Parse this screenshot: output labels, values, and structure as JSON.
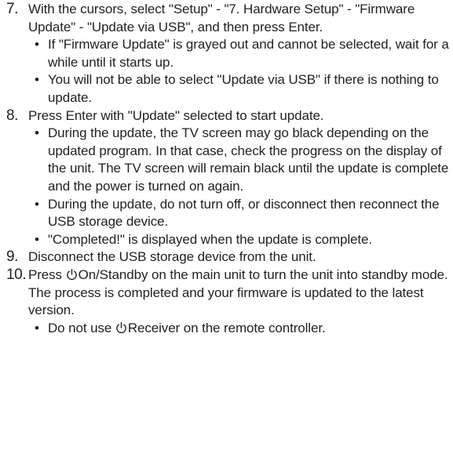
{
  "steps": [
    {
      "number": "7.",
      "text": "With the cursors, select \"Setup\" - \"7. Hardware Setup\" - \"Firmware Update\" - \"Update via USB\", and then press Enter.",
      "bullets": [
        "If \"Firmware Update\" is grayed out and cannot be selected, wait for a while until it starts up.",
        "You will not be able to select \"Update via USB\" if there is nothing to update."
      ]
    },
    {
      "number": "8.",
      "text": "Press Enter with \"Update\" selected to start update.",
      "bullets": [
        "During the update, the TV screen may go black depending on the updated program. In that case, check the progress on the display of the unit. The TV screen will remain black until the update is complete and the power is turned on again.",
        "During the update, do not turn off, or disconnect then reconnect the USB storage device.",
        "\"Completed!\" is displayed when the update is complete."
      ]
    },
    {
      "number": "9.",
      "text": "Disconnect the USB storage device from the unit."
    },
    {
      "number": "10.",
      "text_before_icon": "Press ",
      "icon": "power-standby-icon",
      "text_after_icon": "On/Standby on the main unit to turn the unit into standby mode. The process is completed and your firmware is updated to the latest version.",
      "bullet_before_icon": "Do not use ",
      "bullet_icon": "power-standby-icon",
      "bullet_after_icon": "Receiver on the remote controller."
    }
  ],
  "bullet_glyph": "•",
  "colors": {
    "text": "#231f20",
    "background": "#ffffff"
  }
}
